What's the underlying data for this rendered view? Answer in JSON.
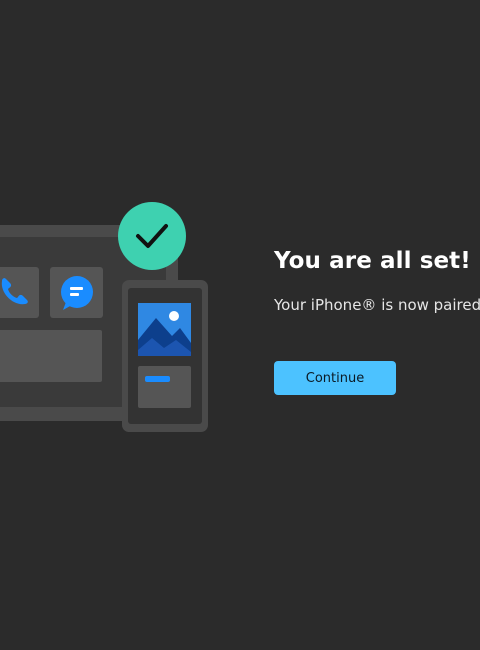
{
  "dialog": {
    "headline": "You are all set!",
    "message": "Your iPhone® is now paired",
    "continue_label": "Continue"
  },
  "illustration": {
    "icons": [
      "phone-call-icon",
      "chat-bubble-icon",
      "photo-icon",
      "checkmark-icon"
    ]
  },
  "colors": {
    "background": "#2b2b2b",
    "accent": "#4cc2ff",
    "check_badge": "#3ed1b0",
    "icon_blue": "#1a8cff"
  }
}
